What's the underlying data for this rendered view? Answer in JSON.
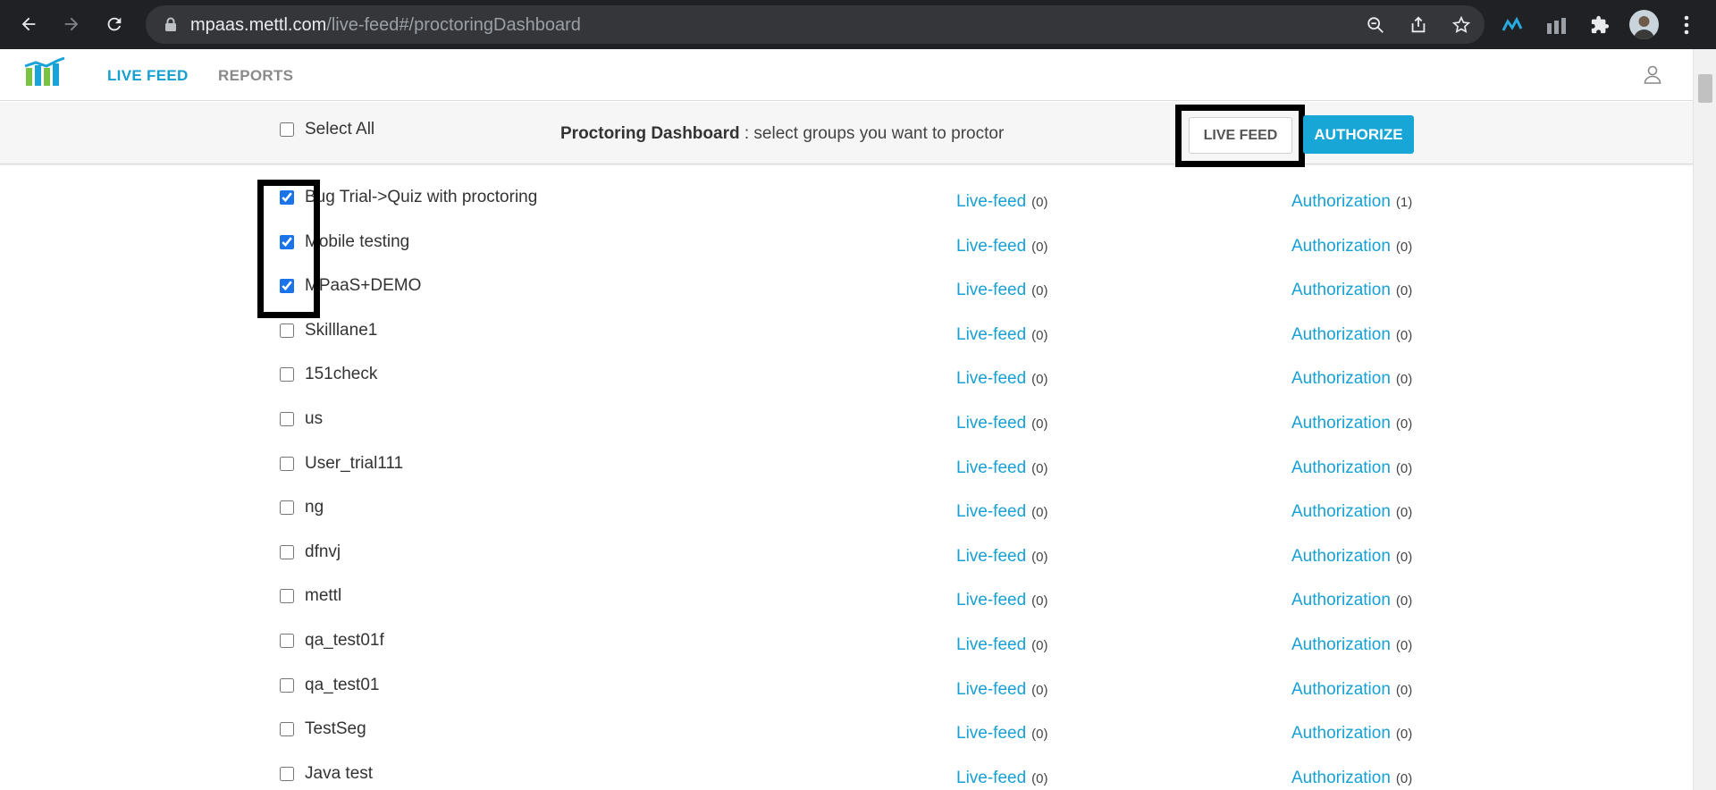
{
  "browser": {
    "url_host": "mpaas.mettl.com",
    "url_path": "/live-feed#/proctoringDashboard"
  },
  "header": {
    "nav_live_feed": "LIVE FEED",
    "nav_reports": "REPORTS"
  },
  "toolbar": {
    "select_all_label": "Select All",
    "title_bold": "Proctoring Dashboard",
    "title_rest": " : select groups you want to proctor",
    "live_feed_button": "LIVE FEED",
    "authorize_button": "AUTHORIZE"
  },
  "link_labels": {
    "live_feed": "Live-feed",
    "authorization": "Authorization"
  },
  "groups": [
    {
      "name": "Bug Trial->Quiz with proctoring",
      "checked": true,
      "live_feed_count": "(0)",
      "authorization_count": "(1)"
    },
    {
      "name": "Mobile testing",
      "checked": true,
      "live_feed_count": "(0)",
      "authorization_count": "(0)"
    },
    {
      "name": "MPaaS+DEMO",
      "checked": true,
      "live_feed_count": "(0)",
      "authorization_count": "(0)"
    },
    {
      "name": "Skilllane1",
      "checked": false,
      "live_feed_count": "(0)",
      "authorization_count": "(0)"
    },
    {
      "name": "151check",
      "checked": false,
      "live_feed_count": "(0)",
      "authorization_count": "(0)"
    },
    {
      "name": "us",
      "checked": false,
      "live_feed_count": "(0)",
      "authorization_count": "(0)"
    },
    {
      "name": "User_trial111",
      "checked": false,
      "live_feed_count": "(0)",
      "authorization_count": "(0)"
    },
    {
      "name": "ng",
      "checked": false,
      "live_feed_count": "(0)",
      "authorization_count": "(0)"
    },
    {
      "name": "dfnvj",
      "checked": false,
      "live_feed_count": "(0)",
      "authorization_count": "(0)"
    },
    {
      "name": "mettl",
      "checked": false,
      "live_feed_count": "(0)",
      "authorization_count": "(0)"
    },
    {
      "name": "qa_test01f",
      "checked": false,
      "live_feed_count": "(0)",
      "authorization_count": "(0)"
    },
    {
      "name": "qa_test01",
      "checked": false,
      "live_feed_count": "(0)",
      "authorization_count": "(0)"
    },
    {
      "name": "TestSeg",
      "checked": false,
      "live_feed_count": "(0)",
      "authorization_count": "(0)"
    },
    {
      "name": "Java test",
      "checked": false,
      "live_feed_count": "(0)",
      "authorization_count": "(0)"
    }
  ],
  "colors": {
    "accent": "#17a0d3",
    "authorize_bg": "#17a6d6",
    "chrome_bg": "#202124"
  }
}
